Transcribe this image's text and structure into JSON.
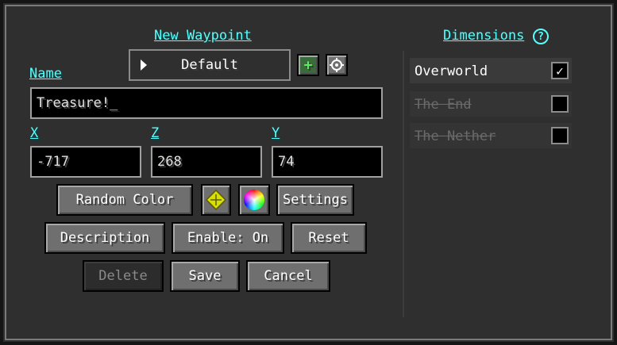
{
  "header": {
    "title": "New Waypoint"
  },
  "form": {
    "name_label": "Name",
    "name_value": "Treasure!_",
    "set_dropdown": {
      "selected": "Default"
    },
    "x_label": "X",
    "x_value": "-717",
    "z_label": "Z",
    "z_value": "268",
    "y_label": "Y",
    "y_value": "74"
  },
  "buttons": {
    "random_color": "Random Color",
    "settings": "Settings",
    "description": "Description",
    "enable": "Enable: On",
    "reset": "Reset",
    "delete": "Delete",
    "save": "Save",
    "cancel": "Cancel",
    "add_set_glyph": "+",
    "help_glyph": "?"
  },
  "dimensions": {
    "title": "Dimensions",
    "items": [
      {
        "label": "Overworld",
        "checked": true,
        "mark": "✓"
      },
      {
        "label": "The End",
        "checked": false,
        "mark": ""
      },
      {
        "label": "The Nether",
        "checked": false,
        "mark": ""
      }
    ]
  },
  "colors": {
    "link": "#55ffff",
    "waypoint_icon": "#d8e000",
    "add_button": "#2e7d32"
  },
  "icons": {
    "add_set": "plus-icon",
    "edit_set": "gear-icon",
    "waypoint_icon": "diamond-icon",
    "color_picker": "color-wheel-icon",
    "dropdown_arrow": "triangle-right-icon",
    "dimensions_help": "help-icon"
  }
}
